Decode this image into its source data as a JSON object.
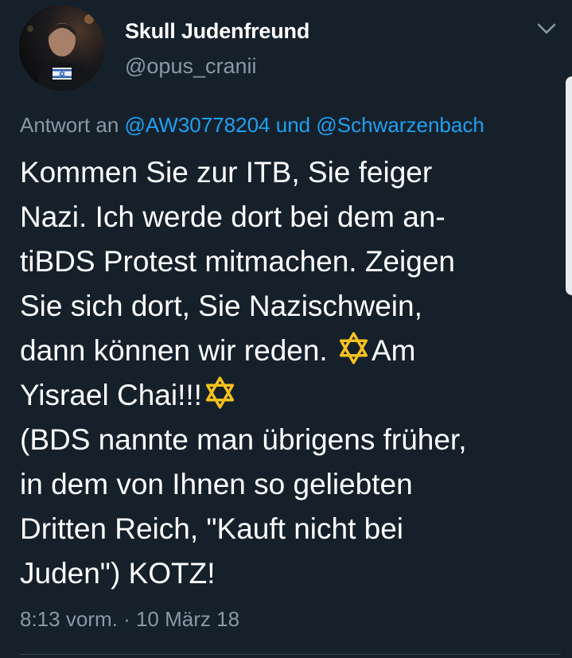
{
  "author": {
    "display_name": "Skull Judenfreund",
    "handle": "@opus_cranii"
  },
  "reply": {
    "prefix": "Antwort an",
    "mention1": "@AW30778204",
    "connector": "und",
    "mention2": "@Schwarzenbach"
  },
  "tweet": {
    "lines": [
      "Kommen Sie zur ITB, Sie feiger",
      "Nazi. Ich werde dort bei dem an-",
      "tiBDS Protest mitmachen. Zeigen",
      "Sie sich dort, Sie Nazischwein,",
      "dann können wir reden.",
      "Am",
      "Yisrael Chai!!!",
      "(BDS nannte man übrigens früher,",
      "in dem von Ihnen so geliebten",
      "Dritten Reich, \"Kauft nicht bei",
      "Juden\") KOTZ!"
    ],
    "emoji": "star-of-david-icon"
  },
  "meta": {
    "time": "8:13 vorm.",
    "separator": "·",
    "date": "10 März 18"
  },
  "colors": {
    "background": "#15202b",
    "text": "#ffffff",
    "secondary": "#8899a6",
    "link": "#1da1f2",
    "emoji_gold": "#f4c11c"
  }
}
